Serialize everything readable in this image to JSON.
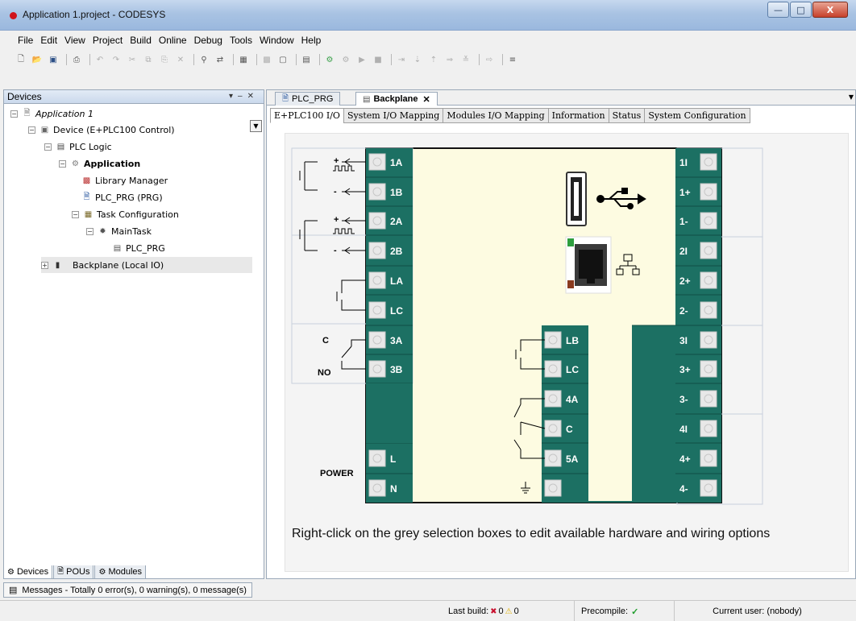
{
  "window": {
    "title": "Application 1.project - CODESYS"
  },
  "menu": [
    "File",
    "Edit",
    "View",
    "Project",
    "Build",
    "Online",
    "Debug",
    "Tools",
    "Window",
    "Help"
  ],
  "devices_panel": {
    "title": "Devices",
    "tree": [
      {
        "label": "Application 1",
        "level": 0,
        "italic": true
      },
      {
        "label": "Device (E+PLC100 Control)",
        "level": 1
      },
      {
        "label": "PLC Logic",
        "level": 2
      },
      {
        "label": "Application",
        "level": 3,
        "bold": true
      },
      {
        "label": "Library Manager",
        "level": 4
      },
      {
        "label": "PLC_PRG (PRG)",
        "level": 4
      },
      {
        "label": "Task Configuration",
        "level": 4
      },
      {
        "label": "MainTask",
        "level": 5
      },
      {
        "label": "PLC_PRG",
        "level": 6
      },
      {
        "label": "Backplane (Local IO)",
        "level": 1,
        "selected": true
      }
    ],
    "bottom_tabs": [
      "Devices",
      "POUs",
      "Modules"
    ]
  },
  "messages": "Messages - Totally 0 error(s), 0 warning(s), 0 message(s)",
  "editor": {
    "doc_tabs": [
      "PLC_PRG",
      "Backplane"
    ],
    "sub_tabs": [
      "E+PLC100 I/O",
      "System I/O Mapping",
      "Modules I/O Mapping",
      "Information",
      "Status",
      "System Configuration"
    ],
    "left_terminals": [
      "1A",
      "1B",
      "2A",
      "2B",
      "LA",
      "LC",
      "3A",
      "3B",
      "L",
      "N"
    ],
    "center_terminals": [
      "LB",
      "LC",
      "4A",
      "C",
      "5A",
      ""
    ],
    "right_terminals": [
      "1I",
      "1+",
      "1-",
      "2I",
      "2+",
      "2-",
      "3I",
      "3+",
      "3-",
      "4I",
      "4+",
      "4-"
    ],
    "wire_labels": {
      "plus": "+",
      "minus": "-",
      "c": "C",
      "no": "NO",
      "power": "POWER"
    },
    "hint": "Right-click on the grey selection boxes to edit available hardware and wiring options"
  },
  "status": {
    "last_build_label": "Last build:",
    "errors": "0",
    "warnings": "0",
    "precompile_label": "Precompile:",
    "precompile_ok": "✓",
    "user": "Current user: (nobody)"
  },
  "colors": {
    "terminal_green": "#1c7063",
    "board_bg": "#fdfbe1"
  }
}
